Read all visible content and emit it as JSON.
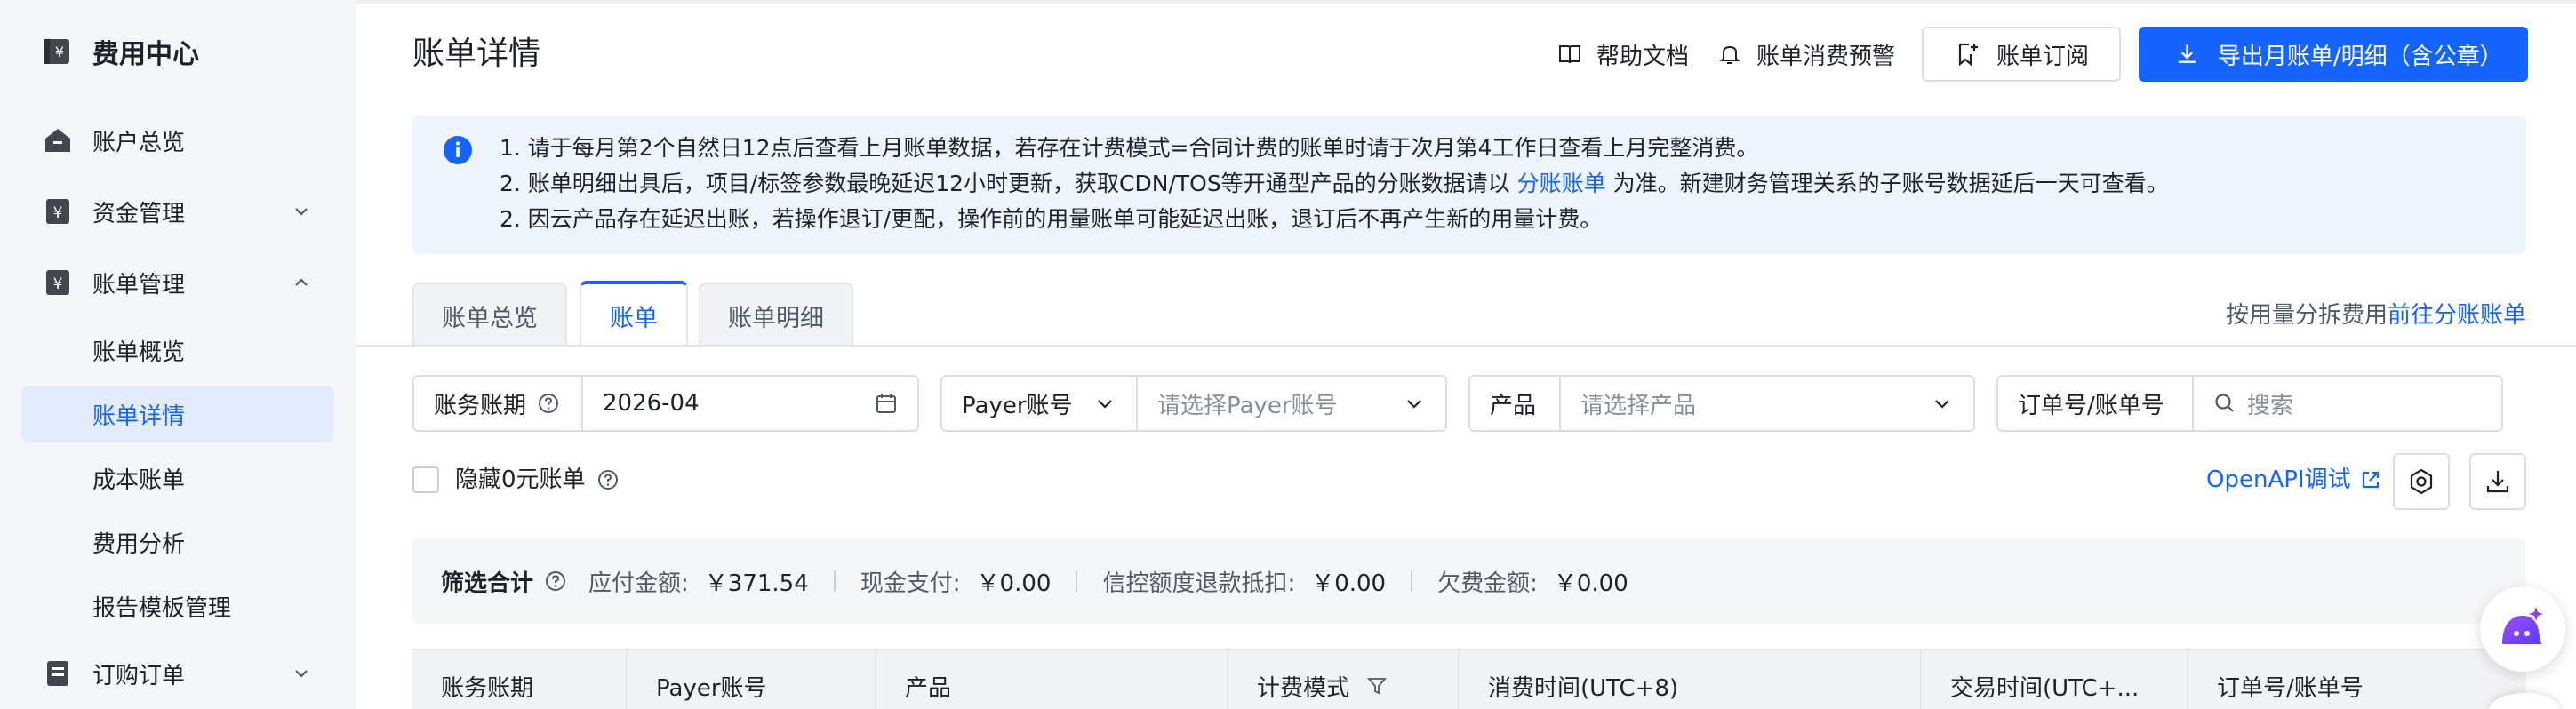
{
  "sidebar": {
    "brand": "费用中心",
    "items": [
      {
        "label": "账户总览",
        "icon": "house-icon"
      },
      {
        "label": "资金管理",
        "icon": "yuan-icon",
        "chevron": "chevron-down-icon"
      },
      {
        "label": "账单管理",
        "icon": "bill-icon",
        "chevron": "chevron-up-icon"
      }
    ],
    "sub_items": [
      "账单概览",
      "账单详情",
      "成本账单",
      "费用分析",
      "报告模板管理"
    ],
    "active_sub": "账单详情",
    "order_item": {
      "label": "订购订单",
      "icon": "order-icon",
      "chevron": "chevron-down-icon"
    }
  },
  "header": {
    "title": "账单详情",
    "help_doc": "帮助文档",
    "alert": "账单消费预警",
    "subscribe": "账单订阅",
    "export": "导出月账单/明细（含公章）"
  },
  "notice": {
    "line1": "1. 请于每月第2个自然日12点后查看上月账单数据，若存在计费模式=合同计费的账单时请于次月第4工作日查看上月完整消费。",
    "line2_pre": "2. 账单明细出具后，项目/标签参数最晚延迟12小时更新，获取CDN/TOS等开通型产品的分账数据请以 ",
    "line2_link": "分账账单",
    "line2_post": " 为准。新建财务管理关系的子账号数据延后一天可查看。",
    "line3": "2. 因云产品存在延迟出账，若操作退订/更配，操作前的用量账单可能延迟出账，退订后不再产生新的用量计费。"
  },
  "tabs": [
    "账单总览",
    "账单",
    "账单明细"
  ],
  "active_tab": "账单",
  "split_hint": {
    "text": "按用量分拆费用",
    "link": "前往分账账单"
  },
  "filters": {
    "period_label": "账务账期",
    "period_value": "2026-04",
    "payer_type": "Payer账号",
    "payer_placeholder": "请选择Payer账号",
    "product_label": "产品",
    "product_placeholder": "请选择产品",
    "order_label": "订单号/账单号",
    "search_placeholder": "搜索"
  },
  "hide_zero": "隐藏0元账单",
  "openapi": "OpenAPI调试",
  "summary": {
    "title": "筛选合计",
    "payable_label": "应付金额:",
    "payable_value": "￥371.54",
    "cash_label": "现金支付:",
    "cash_value": "￥0.00",
    "credit_label": "信控额度退款抵扣:",
    "credit_value": "￥0.00",
    "owed_label": "欠费金额:",
    "owed_value": "￥0.00"
  },
  "table": {
    "columns": [
      "账务账期",
      "Payer账号",
      "产品",
      "计费模式",
      "消费时间(UTC+8)",
      "交易时间(UTC+...",
      "订单号/账单号"
    ]
  },
  "colors": {
    "primary": "#1664ff",
    "sidebar_bg": "#f5f6f8",
    "notice_bg": "#eff4ff"
  }
}
